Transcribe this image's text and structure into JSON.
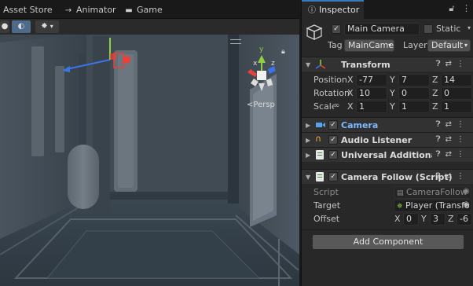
{
  "top_tabs": [
    {
      "label": "Asset Store",
      "icon": "asset-store-icon"
    },
    {
      "label": "Animator",
      "icon": "animator-icon"
    },
    {
      "label": "Game",
      "icon": "game-icon"
    }
  ],
  "scene": {
    "projection_label": "Persp",
    "gizmo_axes": {
      "x": "x",
      "y": "y",
      "z": "z"
    }
  },
  "inspector": {
    "tab_label": "Inspector",
    "object": {
      "name": "Main Camera",
      "active": true,
      "static_label": "Static",
      "static_checked": false,
      "tag_label": "Tag",
      "tag_value": "MainCame",
      "layer_label": "Layer",
      "layer_value": "Default"
    },
    "transform": {
      "title": "Transform",
      "position_label": "Position",
      "rotation_label": "Rotation",
      "scale_label": "Scale",
      "position": {
        "x": "-77",
        "y": "7",
        "z": "14"
      },
      "rotation": {
        "x": "10",
        "y": "0",
        "z": "0"
      },
      "scale": {
        "x": "1",
        "y": "1",
        "z": "1"
      }
    },
    "components": [
      {
        "title": "Camera",
        "icon": "camera-icon",
        "enabled": true,
        "collapsed": true,
        "highlight": true
      },
      {
        "title": "Audio Listener",
        "icon": "headphones-icon",
        "enabled": true,
        "collapsed": true,
        "highlight": false
      },
      {
        "title": "Universal Additional Ca",
        "icon": "script-icon",
        "enabled": true,
        "collapsed": true,
        "highlight": false
      }
    ],
    "camera_follow": {
      "title": "Camera Follow (Script)",
      "script_label": "Script",
      "script_value": "CameraFollow",
      "target_label": "Target",
      "target_value": "Player (Transfo",
      "offset_label": "Offset",
      "offset": {
        "x": "0",
        "y": "3",
        "z": "-6"
      }
    },
    "add_component_label": "Add Component"
  },
  "colors": {
    "accent": "#3a79bb",
    "axis_x": "#e8413a",
    "axis_y": "#8ed13d",
    "axis_z": "#3b74e8",
    "camera_title": "#7cb8ff"
  }
}
